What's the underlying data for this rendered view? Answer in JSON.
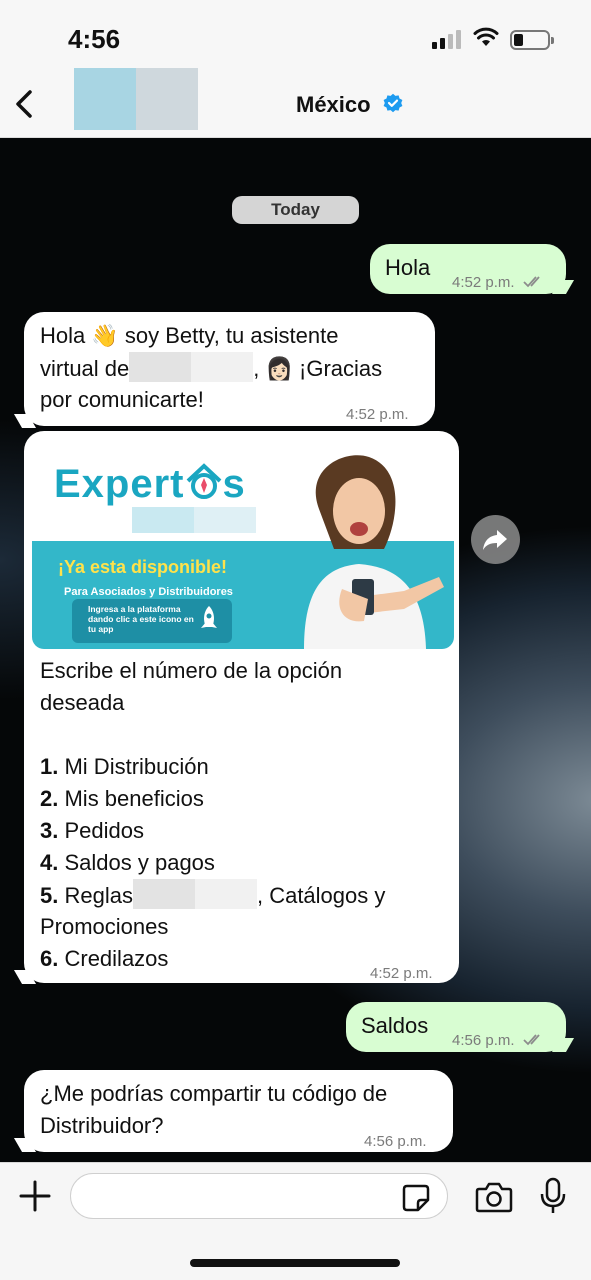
{
  "status_bar": {
    "time": "4:56"
  },
  "header": {
    "back_icon": "chevron-left-icon",
    "contact_name": "México",
    "verified_icon": "verified-badge-icon"
  },
  "date_label": "Today",
  "messages": [
    {
      "direction": "out",
      "text": "Hola",
      "time": "4:52 p.m.",
      "status": "read"
    },
    {
      "direction": "in",
      "line1": "Hola 👋 soy Betty, tu asistente",
      "line2_pre": "virtual de",
      "line2_post": ", 👩🏻 ¡Gracias",
      "line3": "por comunicarte!",
      "time": "4:52 p.m."
    },
    {
      "direction": "in",
      "image": {
        "logo": "Expert",
        "logo_suffix": "s",
        "headline": "¡Ya esta disponible!",
        "subheadline": "Para Asociados y Distribuidores",
        "box_text": "Ingresa a la plataforma dando clic a este icono en tu app"
      },
      "intro_line1": "Escribe el número de la opción",
      "intro_line2": "deseada",
      "options": [
        {
          "num": "1.",
          "label": "Mi Distribución"
        },
        {
          "num": "2.",
          "label": "Mis beneficios"
        },
        {
          "num": "3.",
          "label": "Pedidos"
        },
        {
          "num": "4.",
          "label": "Saldos y pagos"
        },
        {
          "num": "5.",
          "label_pre": "Reglas",
          "label_post": ", Catálogos y"
        },
        {
          "num": "",
          "label": "Promociones"
        },
        {
          "num": "6.",
          "label": "Credilazos"
        }
      ],
      "time": "4:52 p.m."
    },
    {
      "direction": "out",
      "text": "Saldos",
      "time": "4:56 p.m.",
      "status": "read"
    },
    {
      "direction": "in",
      "line1": "¿Me podrías compartir tu código de",
      "line2": "Distribuidor?",
      "time": "4:56 p.m."
    }
  ],
  "composer": {
    "placeholder": "",
    "plus_icon": "plus-icon",
    "sticker_icon": "sticker-icon",
    "camera_icon": "camera-icon",
    "mic_icon": "microphone-icon"
  },
  "colors": {
    "outgoing_bubble": "#d8fdd2",
    "incoming_bubble": "#ffffff",
    "verified_blue": "#1d9bf0",
    "promo_teal": "#33b7c9",
    "promo_yellow": "#ffe24a"
  }
}
